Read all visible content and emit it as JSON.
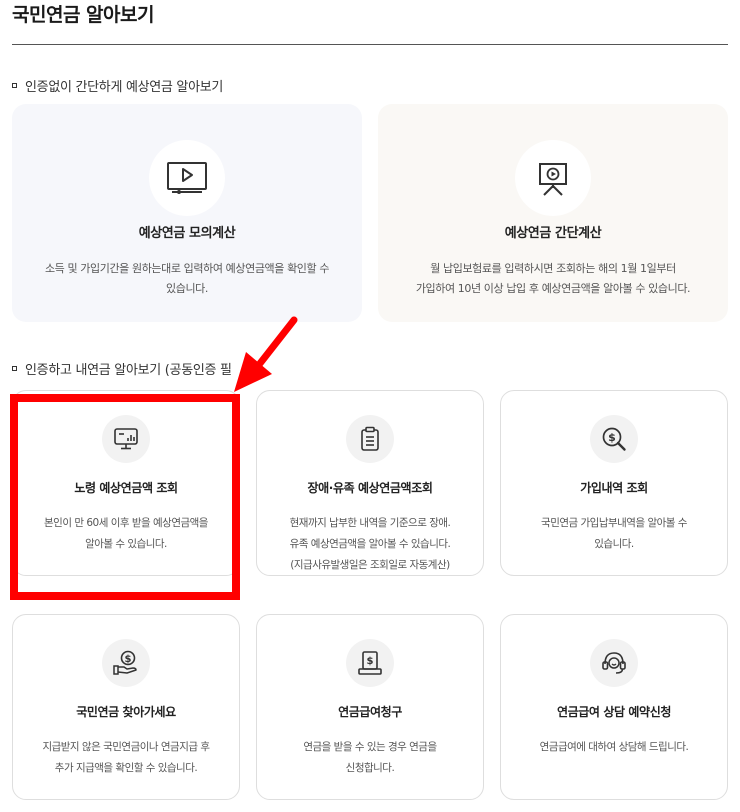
{
  "page": {
    "title": "국민연금 알아보기"
  },
  "section1": {
    "heading": "인증없이 간단하게 예상연금 알아보기",
    "cards": [
      {
        "title": "예상연금 모의계산",
        "desc": [
          "소득 및 가입기간을 원하는대로 입력하여 예상연금액을 확인할 수",
          "있습니다."
        ],
        "icon": "video-play-icon",
        "bg": "#f6f7fb"
      },
      {
        "title": "예상연금 간단계산",
        "desc": [
          "월 납입보험료를 입력하시면 조회하는 해의 1월 1일부터",
          "가입하여 10년 이상 납입 후 예상연금액을 알아볼 수 있습니다."
        ],
        "icon": "presentation-board-icon",
        "bg": "#faf8f5"
      }
    ]
  },
  "section2": {
    "heading": "인증하고 내연금 알아보기 (공동인증 필",
    "cards": [
      {
        "title": "노령 예상연금액 조회",
        "desc": [
          "본인이 만 60세 이후 받을 예상연금액을",
          "알아볼 수 있습니다."
        ],
        "icon": "monitor-chart-icon"
      },
      {
        "title": "장애·유족 예상연금액조회",
        "desc": [
          "현재까지 납부한 내역을 기준으로 장애.",
          "유족 예상연금액을 알아볼 수 있습니다.",
          "(지급사유발생일은 조회일로 자동계산)"
        ],
        "icon": "clipboard-icon"
      },
      {
        "title": "가입내역 조회",
        "desc": [
          "국민연금 가입납부내역을 알아볼 수",
          "있습니다."
        ],
        "icon": "money-search-icon"
      },
      {
        "title": "국민연금 찾아가세요",
        "desc": [
          "지급받지 않은 국민연금이나 연금지급 후",
          "추가 지급액을 확인할 수 있습니다."
        ],
        "icon": "hand-coin-icon"
      },
      {
        "title": "연금급여청구",
        "desc": [
          "연금을 받을 수 있는 경우 연금을",
          "신청합니다."
        ],
        "icon": "money-document-icon"
      },
      {
        "title": "연금급여 상담 예약신청",
        "desc": [
          "연금급여에 대하여 상담해 드립니다."
        ],
        "icon": "headset-icon"
      }
    ]
  },
  "annotation": {
    "color": "#ff0000"
  }
}
